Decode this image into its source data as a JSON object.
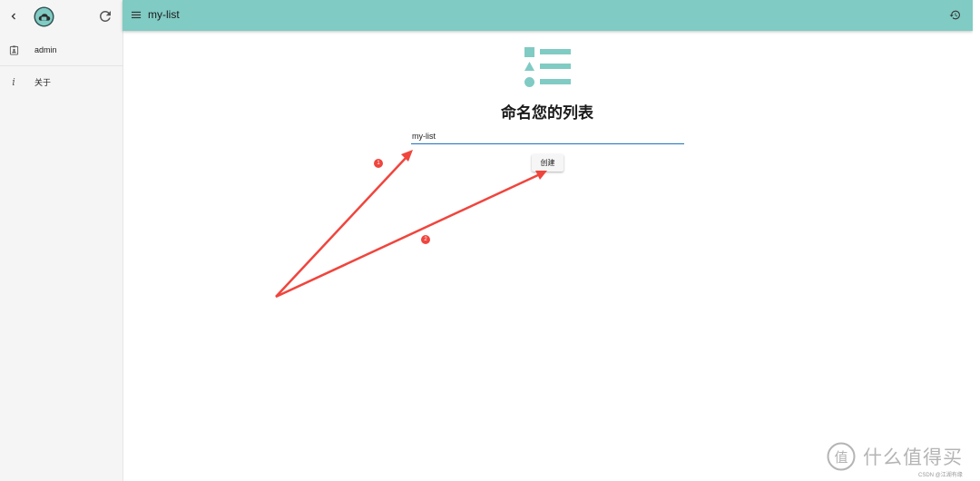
{
  "sidebar": {
    "items": [
      {
        "label": "admin",
        "icon": "user-badge-icon"
      },
      {
        "label": "关于",
        "icon": "info-icon"
      }
    ]
  },
  "header": {
    "title": "my-list"
  },
  "main": {
    "heading": "命名您的列表",
    "input_value": "my-list",
    "create_label": "创建"
  },
  "annotations": {
    "badges": [
      "1",
      "2"
    ],
    "arrow_color": "#f0453d"
  },
  "watermark": {
    "logo_text": "值",
    "text": "什么值得买",
    "sub": "CSDN @江湖有缘"
  },
  "colors": {
    "accent": "#80cbc4",
    "input_underline": "#1e73be"
  }
}
